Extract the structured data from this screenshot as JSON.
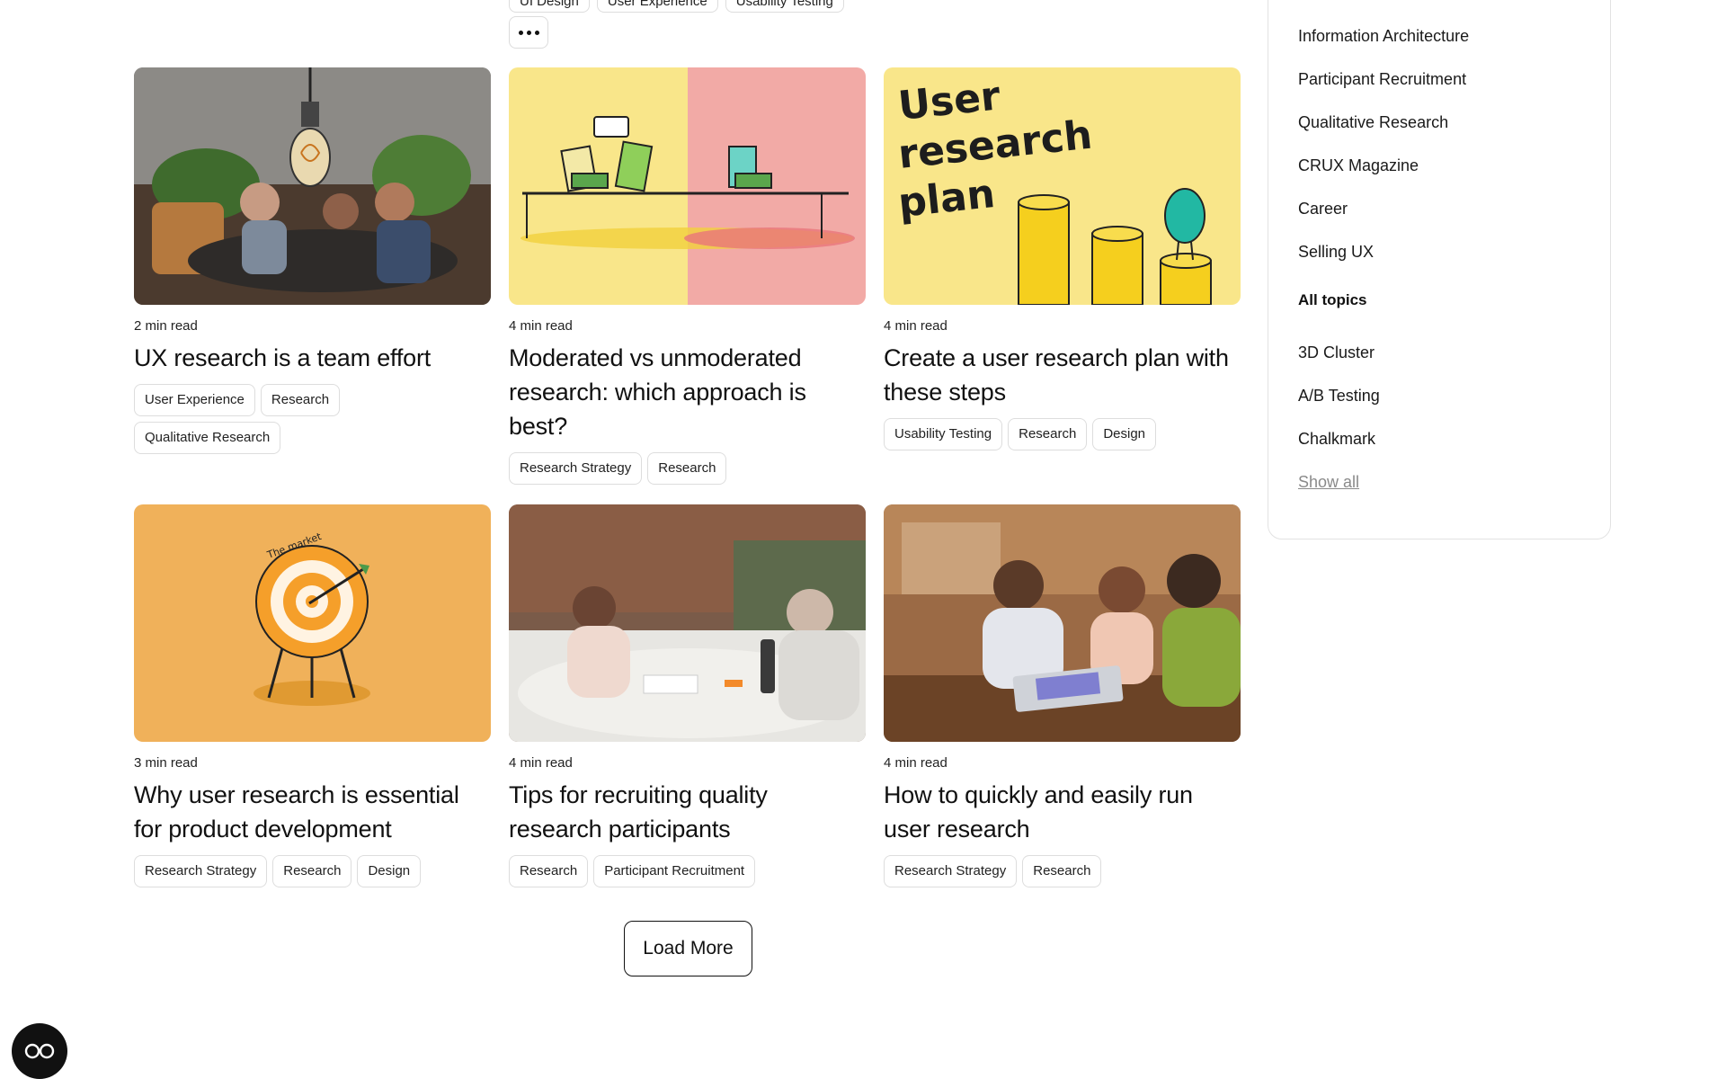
{
  "top_tags": [
    "UI Design",
    "User Experience",
    "Usability Testing"
  ],
  "articles": [
    {
      "read": "2 min read",
      "title": "UX research is a team effort",
      "tags": [
        "User Experience",
        "Research",
        "Qualitative Research"
      ],
      "image": "photo-team-meeting-lightbulb"
    },
    {
      "read": "4 min read",
      "title": "Moderated vs unmoderated research: which approach is best?",
      "tags": [
        "Research Strategy",
        "Research"
      ],
      "image": "illustration-yellow-pink-table"
    },
    {
      "read": "4 min read",
      "title": "Create a user research plan with these steps",
      "tags": [
        "Usability Testing",
        "Research",
        "Design"
      ],
      "image": "illustration-research-plan",
      "image_text": [
        "User",
        "research",
        "plan"
      ]
    },
    {
      "read": "3 min read",
      "title": "Why user research is essential for product development",
      "tags": [
        "Research Strategy",
        "Research",
        "Design"
      ],
      "image": "illustration-target",
      "image_text": [
        "The market"
      ]
    },
    {
      "read": "4 min read",
      "title": "Tips for recruiting quality research participants",
      "tags": [
        "Research",
        "Participant Recruitment"
      ],
      "image": "photo-two-people-writing"
    },
    {
      "read": "4 min read",
      "title": "How to quickly and easily run user research",
      "tags": [
        "Research Strategy",
        "Research"
      ],
      "image": "photo-group-laptop"
    }
  ],
  "load_more": "Load More",
  "sidebar": {
    "items": [
      "Information Architecture",
      "Participant Recruitment",
      "Qualitative Research",
      "CRUX Magazine",
      "Career",
      "Selling UX"
    ],
    "heading": "All topics",
    "topics": [
      "3D Cluster",
      "A/B Testing",
      "Chalkmark"
    ],
    "show_all": "Show all"
  },
  "colors": {
    "yellow": "#f9e68a",
    "pink": "#f2aaa6",
    "orange": "#f0b15a",
    "border": "#dddddd"
  }
}
